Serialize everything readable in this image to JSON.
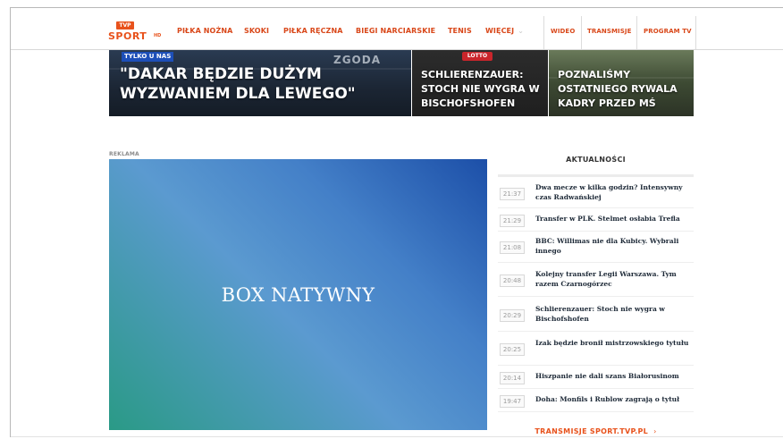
{
  "brand": {
    "logo_top": "TVP",
    "logo_word": "SPORT",
    "logo_suffix": "HD",
    "color": "#e8521c"
  },
  "nav": {
    "items": [
      "PIŁKA NOŻNA",
      "SKOKI",
      "PIŁKA RĘCZNA",
      "BIEGI NARCIARSKIE",
      "TENIS"
    ],
    "more": "WIĘCEJ",
    "chevron": "⌄",
    "right_items": [
      "WIDEO",
      "TRANSMISJE",
      "PROGRAM TV"
    ]
  },
  "hero": {
    "main": {
      "badge": "TYLKO U NAS",
      "decoration": "ZGODA",
      "headline": "\"DAKAR BĘDZIE DUŻYM WYZWANIEM DLA LEWEGO\""
    },
    "mid": {
      "sponsor": "LOTTO",
      "headline": "SCHLIERENZAUER: STOCH NIE WYGRA W BISCHOFSHOFEN"
    },
    "right": {
      "headline": "POZNALIŚMY OSTATNIEGO RYWALA KADRY PRZED MŚ"
    }
  },
  "ad": {
    "label": "REKLAMA",
    "text": "BOX NATYWNY"
  },
  "news": {
    "title": "AKTUALNOŚCI",
    "items": [
      {
        "time": "21:37",
        "text": "Dwa mecze w kilka godzin? Intensywny czas Radwańskiej"
      },
      {
        "time": "21:29",
        "text": "Transfer w PLK. Stelmet osłabia Trefla"
      },
      {
        "time": "21:08",
        "text": "BBC: Willimas nie dla Kubicy. Wybrali innego"
      },
      {
        "time": "20:48",
        "text": "Kolejny transfer Legii Warszawa. Tym razem Czarnogórzec"
      },
      {
        "time": "20:29",
        "text": "Schlierenzauer: Stoch nie wygra w Bischofshofen"
      },
      {
        "time": "20:25",
        "text": "Izak będzie bronił mistrzowskiego tytułu"
      },
      {
        "time": "20:14",
        "text": "Hiszpanie nie dali szans Białorusinom"
      },
      {
        "time": "19:47",
        "text": "Doha: Monfils i Rublow zagrają o tytuł"
      }
    ]
  },
  "footer_link": {
    "label": "TRANSMISJE SPORT.TVP.PL",
    "arrow": "›"
  }
}
